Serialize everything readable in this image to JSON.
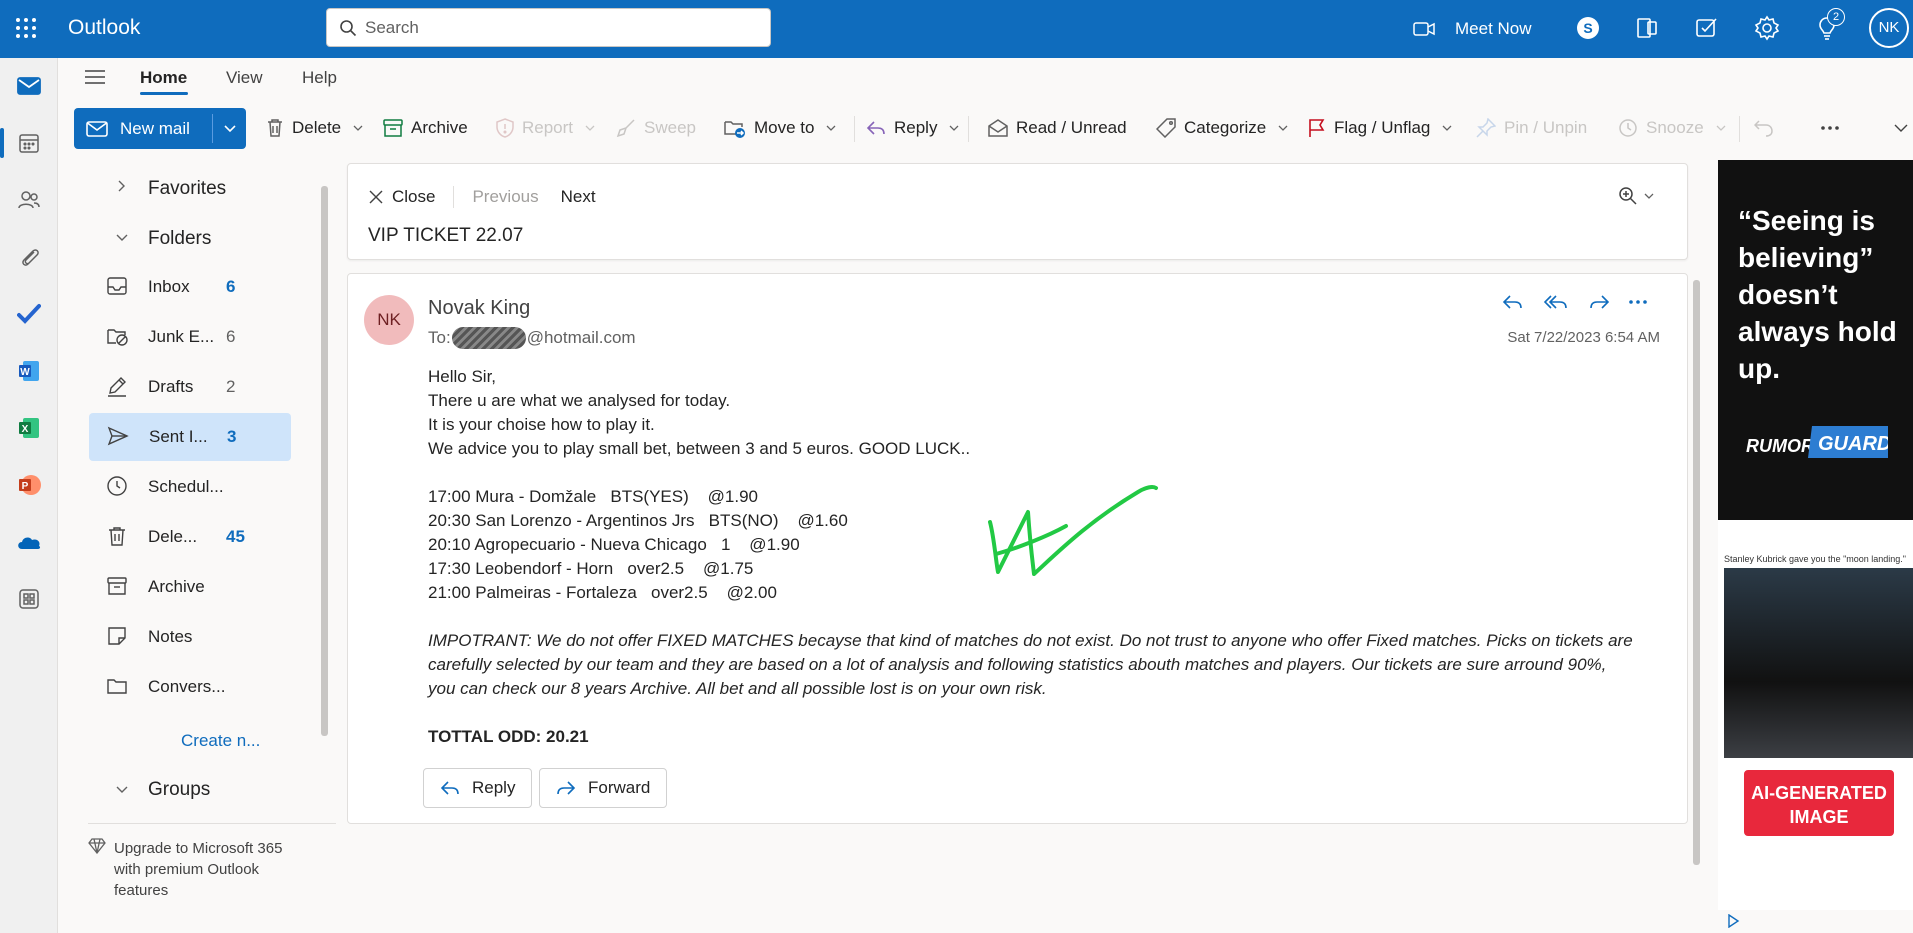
{
  "app": {
    "name": "Outlook"
  },
  "search": {
    "placeholder": "Search"
  },
  "topbar": {
    "meet_now": "Meet Now",
    "notification_count": "2",
    "user_initials": "NK"
  },
  "ribbon": {
    "tabs": [
      "Home",
      "View",
      "Help"
    ],
    "active_tab": "Home",
    "new_mail": "New mail",
    "delete": "Delete",
    "archive": "Archive",
    "report": "Report",
    "sweep": "Sweep",
    "move_to": "Move to",
    "reply": "Reply",
    "read_unread": "Read / Unread",
    "categorize": "Categorize",
    "flag": "Flag / Unflag",
    "pin": "Pin / Unpin",
    "snooze": "Snooze"
  },
  "folders": {
    "favorites": "Favorites",
    "folders": "Folders",
    "items": [
      {
        "label": "Inbox",
        "count": "6",
        "unread": true
      },
      {
        "label": "Junk E...",
        "count": "6",
        "unread": false
      },
      {
        "label": "Drafts",
        "count": "2",
        "unread": false
      },
      {
        "label": "Sent I...",
        "count": "3",
        "unread": true,
        "selected": true
      },
      {
        "label": "Schedul...",
        "count": "",
        "unread": false
      },
      {
        "label": "Dele...",
        "count": "45",
        "unread": true
      },
      {
        "label": "Archive",
        "count": "",
        "unread": false
      },
      {
        "label": "Notes",
        "count": "",
        "unread": false
      },
      {
        "label": "Convers...",
        "count": "",
        "unread": false
      }
    ],
    "create_new": "Create n...",
    "groups": "Groups",
    "upgrade": "Upgrade to Microsoft 365 with premium Outlook features"
  },
  "reading": {
    "close": "Close",
    "previous": "Previous",
    "next": "Next",
    "subject": "VIP TICKET 22.07"
  },
  "message": {
    "avatar": "NK",
    "sender": "Novak King",
    "to_prefix": "To:",
    "to_domain": "@hotmail.com",
    "date": "Sat 7/22/2023 6:54 AM",
    "body_lines": [
      "Hello Sir,",
      "There u are what we analysed for today.",
      "It is your choise how to play it.",
      "We advice you to play small bet, between 3 and 5 euros. GOOD LUCK.."
    ],
    "picks": [
      "17:00 Mura - Domžale   BTS(YES)    @1.90",
      "20:30 San Lorenzo - Argentinos Jrs   BTS(NO)    @1.60",
      "20:10 Agropecuario - Nueva Chicago   1    @1.90",
      "17:30 Leobendorf - Horn   over2.5    @1.75",
      "21:00 Palmeiras - Fortaleza   over2.5    @2.00"
    ],
    "disclaimer": "IMPOTRANT: We do not offer FIXED MATCHES becayse that kind of matches do not exist. Do not trust to anyone who offer Fixed matches. Picks on tickets are carefully selected by our team and they are based on a lot of analysis and following statistics abouth matches and players. Our tickets are sure arround 90%, you can check our 8 years Archive. All bet and all possible lost is on your own risk.",
    "total": "TOTTAL ODD: 20.21",
    "reply_btn": "Reply",
    "forward_btn": "Forward"
  },
  "ad": {
    "quote": "“Seeing is believing” doesn’t always hold up.",
    "logo_left": "RUMOR",
    "logo_right": "GUARD",
    "tweet": "Stanley Kubrick gave you the \"moon landing.\"",
    "badge": "AI-GENERATED IMAGE"
  },
  "colors": {
    "brand": "#0f6cbd",
    "selected": "#cfe4fa",
    "avatar_bg": "#f1bbbc",
    "ad_red": "#e8283c"
  }
}
